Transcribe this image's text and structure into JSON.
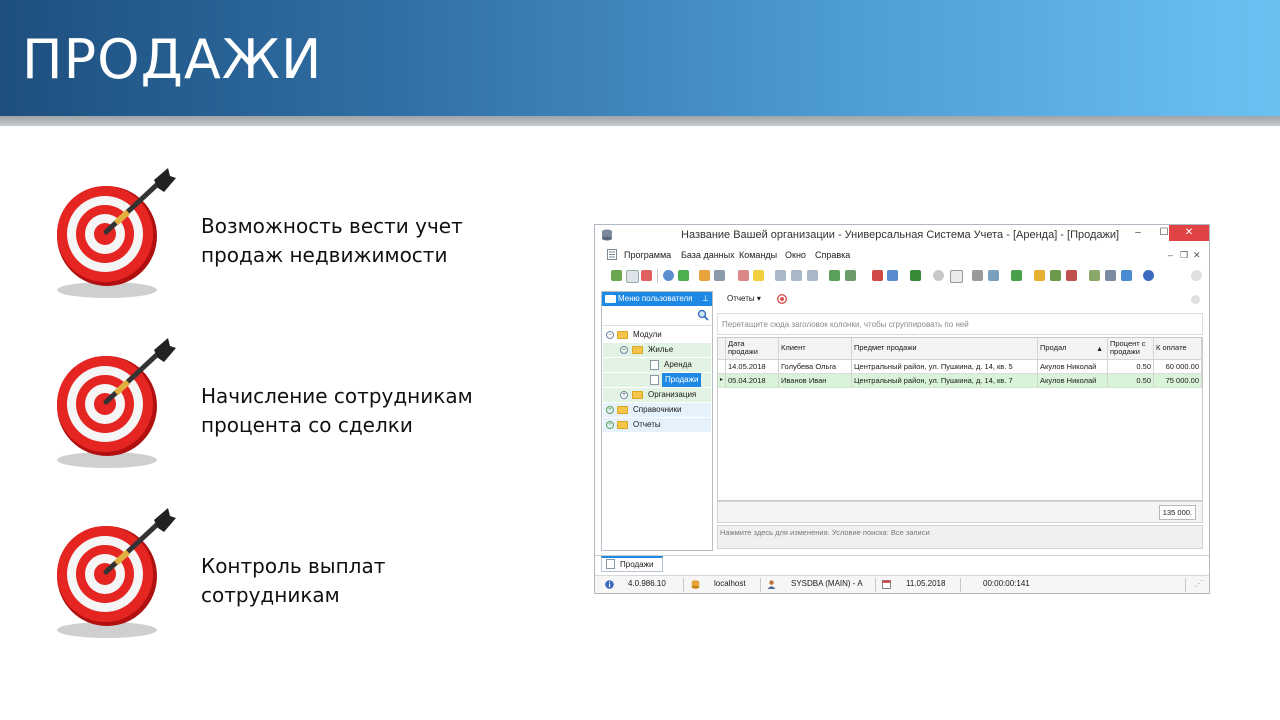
{
  "slide": {
    "title": "ПРОДАЖИ",
    "bullets": [
      {
        "line1": "Возможность вести учет",
        "line2": "продаж недвижимости"
      },
      {
        "line1": "Начисление сотрудникам",
        "line2": "процента со сделки"
      },
      {
        "line1": "Контроль выплат",
        "line2": "сотрудникам"
      }
    ]
  },
  "app": {
    "window_title": "Название Вашей организации - Универсальная Система Учета - [Аренда] - [Продажи]",
    "window_buttons": {
      "minimize": "–",
      "maximize": "☐",
      "close": "✕"
    },
    "menu": [
      "Программа",
      "База данных",
      "Команды",
      "Окно",
      "Справка"
    ],
    "mdi_buttons": {
      "minimize": "–",
      "restore": "❐",
      "close": "✕"
    },
    "left_panel": {
      "title": "Меню пользователя",
      "tree": [
        {
          "label": "Модули",
          "type": "folder",
          "expand": "−"
        },
        {
          "label": "Жилье",
          "type": "folder",
          "expand": "−"
        },
        {
          "label": "Аренда",
          "type": "doc"
        },
        {
          "label": "Продажи",
          "type": "doc",
          "selected": true
        },
        {
          "label": "Организация",
          "type": "folder",
          "expand": "+"
        },
        {
          "label": "Справочники",
          "type": "folder",
          "expand": "+"
        },
        {
          "label": "Отчеты",
          "type": "folder",
          "expand": "+"
        }
      ]
    },
    "reports_button": "Отчеты ▾",
    "group_hint": "Перетащите сюда заголовок колонки, чтобы сгруппировать по ней",
    "grid": {
      "columns": [
        "Дата продажи",
        "Клиент",
        "Предмет продажи",
        "Продал",
        "Процент с продажи",
        "К оплате"
      ],
      "rows": [
        [
          "14.05.2018",
          "Голубева Ольга",
          "Центральный район, ул. Пушкина, д. 14, кв. 5",
          "Акулов Николай",
          "0.50",
          "60 000.00"
        ],
        [
          "05.04.2018",
          "Иванов Иван",
          "Центральный район, ул. Пушкина, д. 14, кв. 7",
          "Акулов Николай",
          "0.50",
          "75 000.00"
        ]
      ],
      "total": "135 000."
    },
    "filter_text": "Нажмите здесь для изменения. Условие поиска: Все записи",
    "tab": "Продажи",
    "status": {
      "version": "4.0.986.10",
      "server": "localhost",
      "user": "SYSDBA (MAIN) - A",
      "date": "11.05.2018",
      "timer": "00:00:00:141"
    }
  }
}
